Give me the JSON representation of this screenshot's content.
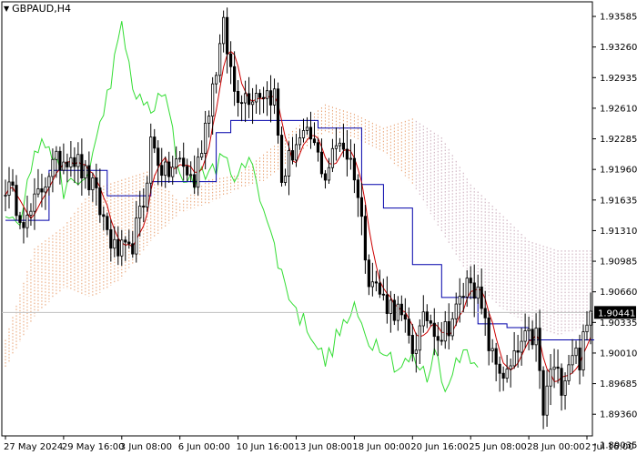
{
  "chart_title": "GBPAUD,H4",
  "price_label": "1.90441",
  "colors": {
    "candle": "#000000",
    "tenkan": "#cc0000",
    "kijun": "#0000aa",
    "chikou": "#33dd33",
    "kumo_up": "#e8a070",
    "kumo_down": "#c8a8b8",
    "price_line": "#c0c0c0"
  },
  "chart_data": {
    "type": "candlestick",
    "symbol": "GBPAUD",
    "timeframe": "H4",
    "ylim": [
      1.8913,
      1.9374
    ],
    "current_price": 1.90441,
    "yticks": [
      "1.93585",
      "1.93260",
      "1.92935",
      "1.92610",
      "1.92285",
      "1.91960",
      "1.91635",
      "1.91310",
      "1.90985",
      "1.90660",
      "1.90335",
      "1.90010",
      "1.89685",
      "1.89360",
      "1.89035"
    ],
    "ytick_values": [
      1.93585,
      1.9326,
      1.92935,
      1.9261,
      1.92285,
      1.9196,
      1.91635,
      1.9131,
      1.90985,
      1.9066,
      1.90335,
      1.9001,
      1.89685,
      1.8936,
      1.89035
    ],
    "xticks": [
      "27 May 2024",
      "29 May 16:00",
      "3 Jun 08:00",
      "6 Jun 00:00",
      "10 Jun 16:00",
      "13 Jun 08:00",
      "18 Jun 00:00",
      "20 Jun 16:00",
      "25 Jun 08:00",
      "28 Jun 00:00",
      "2 Jul 16:00"
    ],
    "xtick_bar_index": [
      0,
      16,
      32,
      48,
      64,
      80,
      96,
      112,
      128,
      144,
      160
    ],
    "bar_count": 162,
    "anchors": [
      [
        0,
        1.918
      ],
      [
        6,
        1.914
      ],
      [
        12,
        1.9195
      ],
      [
        18,
        1.9215
      ],
      [
        24,
        1.9175
      ],
      [
        30,
        1.911
      ],
      [
        34,
        1.9105
      ],
      [
        38,
        1.916
      ],
      [
        40,
        1.9225
      ],
      [
        44,
        1.919
      ],
      [
        48,
        1.9205
      ],
      [
        52,
        1.9182
      ],
      [
        56,
        1.9265
      ],
      [
        60,
        1.9345
      ],
      [
        63,
        1.928
      ],
      [
        66,
        1.9275
      ],
      [
        70,
        1.928
      ],
      [
        74,
        1.9275
      ],
      [
        76,
        1.9185
      ],
      [
        80,
        1.9225
      ],
      [
        84,
        1.9228
      ],
      [
        88,
        1.919
      ],
      [
        92,
        1.923
      ],
      [
        96,
        1.9195
      ],
      [
        100,
        1.9085
      ],
      [
        104,
        1.9058
      ],
      [
        108,
        1.9045
      ],
      [
        112,
        1.9005
      ],
      [
        116,
        1.904
      ],
      [
        120,
        1.902
      ],
      [
        124,
        1.9045
      ],
      [
        128,
        1.9085
      ],
      [
        130,
        1.906
      ],
      [
        134,
        1.8995
      ],
      [
        138,
        1.8975
      ],
      [
        142,
        1.901
      ],
      [
        146,
        1.902
      ],
      [
        148,
        1.8935
      ],
      [
        150,
        1.8985
      ],
      [
        153,
        1.897
      ],
      [
        156,
        1.9005
      ],
      [
        158,
        1.8995
      ],
      [
        161,
        1.9044
      ]
    ],
    "chikou_anchors": [
      [
        0,
        1.9155
      ],
      [
        4,
        1.9145
      ],
      [
        8,
        1.9215
      ],
      [
        12,
        1.9225
      ],
      [
        16,
        1.9175
      ],
      [
        22,
        1.9185
      ],
      [
        26,
        1.924
      ],
      [
        32,
        1.9345
      ],
      [
        36,
        1.927
      ],
      [
        40,
        1.926
      ],
      [
        44,
        1.9275
      ],
      [
        48,
        1.919
      ],
      [
        52,
        1.9185
      ],
      [
        56,
        1.9195
      ],
      [
        60,
        1.9205
      ],
      [
        64,
        1.919
      ],
      [
        68,
        1.9205
      ],
      [
        72,
        1.914
      ],
      [
        76,
        1.9085
      ],
      [
        80,
        1.9045
      ],
      [
        84,
        1.9025
      ],
      [
        88,
        1.899
      ],
      [
        92,
        1.9025
      ],
      [
        96,
        1.9045
      ],
      [
        100,
        1.9015
      ],
      [
        104,
        1.901
      ],
      [
        108,
        1.8985
      ],
      [
        112,
        1.8995
      ],
      [
        116,
        1.8975
      ],
      [
        118,
        1.9005
      ],
      [
        120,
        1.898
      ],
      [
        122,
        1.896
      ],
      [
        124,
        1.8995
      ],
      [
        126,
        1.9005
      ],
      [
        130,
        1.8995
      ]
    ],
    "kijun_steps": [
      [
        0,
        1.9142
      ],
      [
        12,
        1.9195
      ],
      [
        28,
        1.9168
      ],
      [
        40,
        1.9183
      ],
      [
        58,
        1.9235
      ],
      [
        62,
        1.9248
      ],
      [
        86,
        1.924
      ],
      [
        98,
        1.918
      ],
      [
        104,
        1.9155
      ],
      [
        112,
        1.9095
      ],
      [
        120,
        1.906
      ],
      [
        130,
        1.9032
      ],
      [
        138,
        1.9028
      ],
      [
        144,
        1.9015
      ],
      [
        162,
        1.9015
      ]
    ],
    "kumo_upper": [
      [
        0,
        1.9015
      ],
      [
        8,
        1.9112
      ],
      [
        16,
        1.9135
      ],
      [
        24,
        1.9175
      ],
      [
        32,
        1.9185
      ],
      [
        40,
        1.9195
      ],
      [
        48,
        1.916
      ],
      [
        56,
        1.9185
      ],
      [
        64,
        1.919
      ],
      [
        72,
        1.9215
      ],
      [
        80,
        1.924
      ],
      [
        88,
        1.9265
      ],
      [
        96,
        1.9255
      ],
      [
        104,
        1.924
      ],
      [
        112,
        1.925
      ],
      [
        120,
        1.923
      ],
      [
        128,
        1.918
      ],
      [
        136,
        1.915
      ],
      [
        144,
        1.912
      ],
      [
        152,
        1.911
      ],
      [
        162,
        1.911
      ]
    ],
    "kumo_lower": [
      [
        0,
        1.8985
      ],
      [
        8,
        1.904
      ],
      [
        16,
        1.907
      ],
      [
        24,
        1.906
      ],
      [
        32,
        1.908
      ],
      [
        40,
        1.912
      ],
      [
        48,
        1.915
      ],
      [
        56,
        1.916
      ],
      [
        64,
        1.9175
      ],
      [
        72,
        1.9185
      ],
      [
        80,
        1.921
      ],
      [
        88,
        1.9235
      ],
      [
        96,
        1.923
      ],
      [
        104,
        1.9215
      ],
      [
        112,
        1.918
      ],
      [
        120,
        1.913
      ],
      [
        128,
        1.908
      ],
      [
        136,
        1.905
      ],
      [
        144,
        1.903
      ],
      [
        152,
        1.902
      ],
      [
        162,
        1.903
      ]
    ]
  }
}
